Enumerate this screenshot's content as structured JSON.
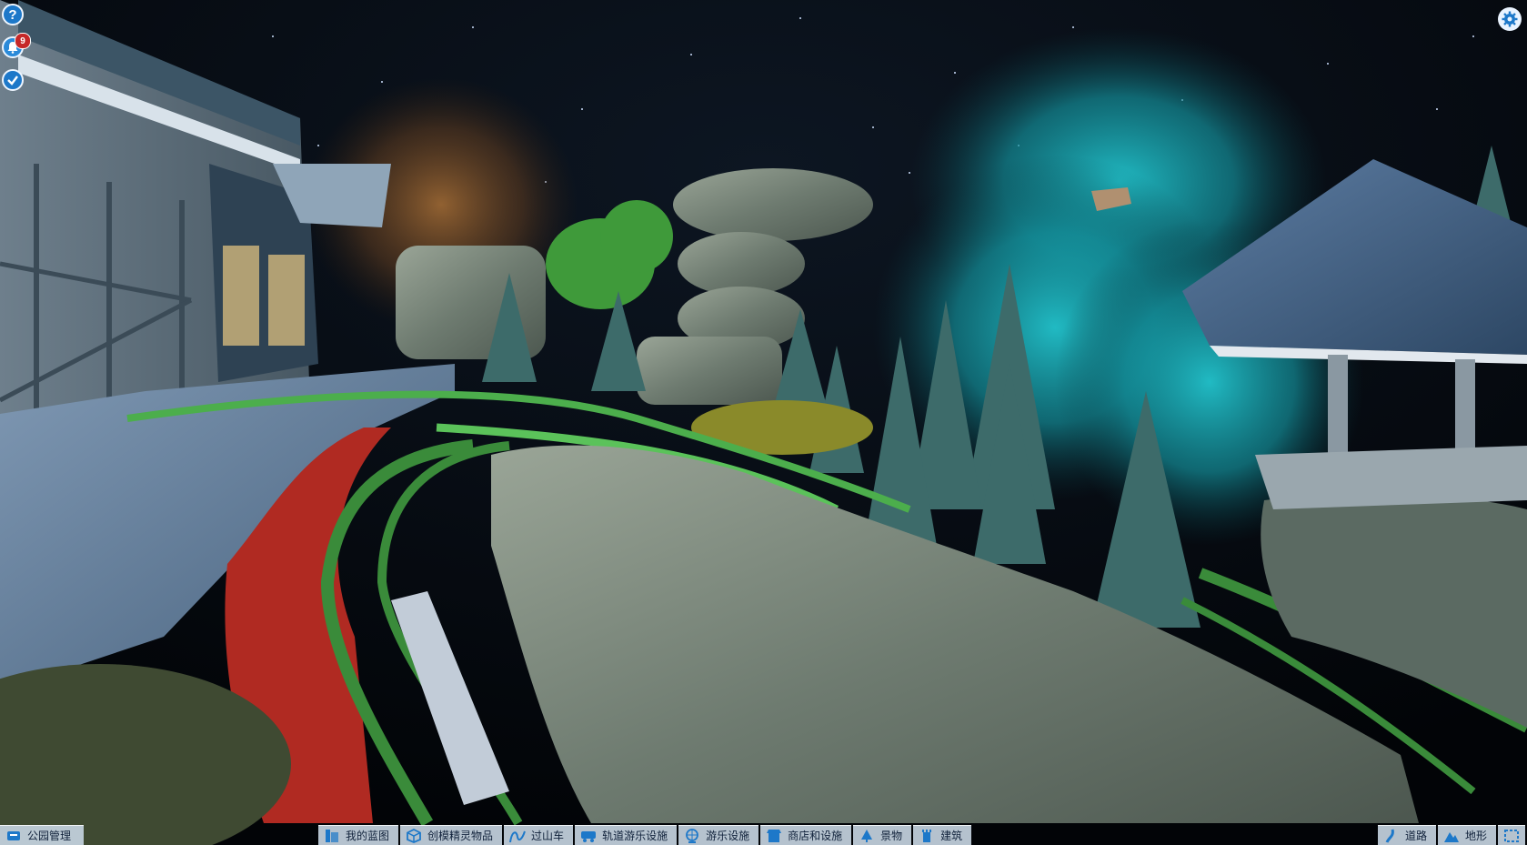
{
  "hud": {
    "help_label": "?",
    "notifications_count": "9"
  },
  "toolbar": {
    "park_management": "公园管理",
    "items": [
      {
        "label": "我的蓝图",
        "icon": "blueprint-icon"
      },
      {
        "label": "创模精灵物品",
        "icon": "cube-icon"
      },
      {
        "label": "过山车",
        "icon": "coaster-icon"
      },
      {
        "label": "轨道游乐设施",
        "icon": "train-icon"
      },
      {
        "label": "游乐设施",
        "icon": "ferris-wheel-icon"
      },
      {
        "label": "商店和设施",
        "icon": "shop-icon"
      },
      {
        "label": "景物",
        "icon": "tree-icon"
      },
      {
        "label": "建筑",
        "icon": "tower-icon"
      }
    ],
    "right_items": [
      {
        "label": "道路",
        "icon": "path-icon"
      },
      {
        "label": "地形",
        "icon": "terrain-icon"
      }
    ]
  },
  "colors": {
    "accent": "#1d78c9",
    "toolbar_bg": "#c4d2e0",
    "track_green": "#4cae4c",
    "smoke_teal": "#1fb3bd"
  }
}
